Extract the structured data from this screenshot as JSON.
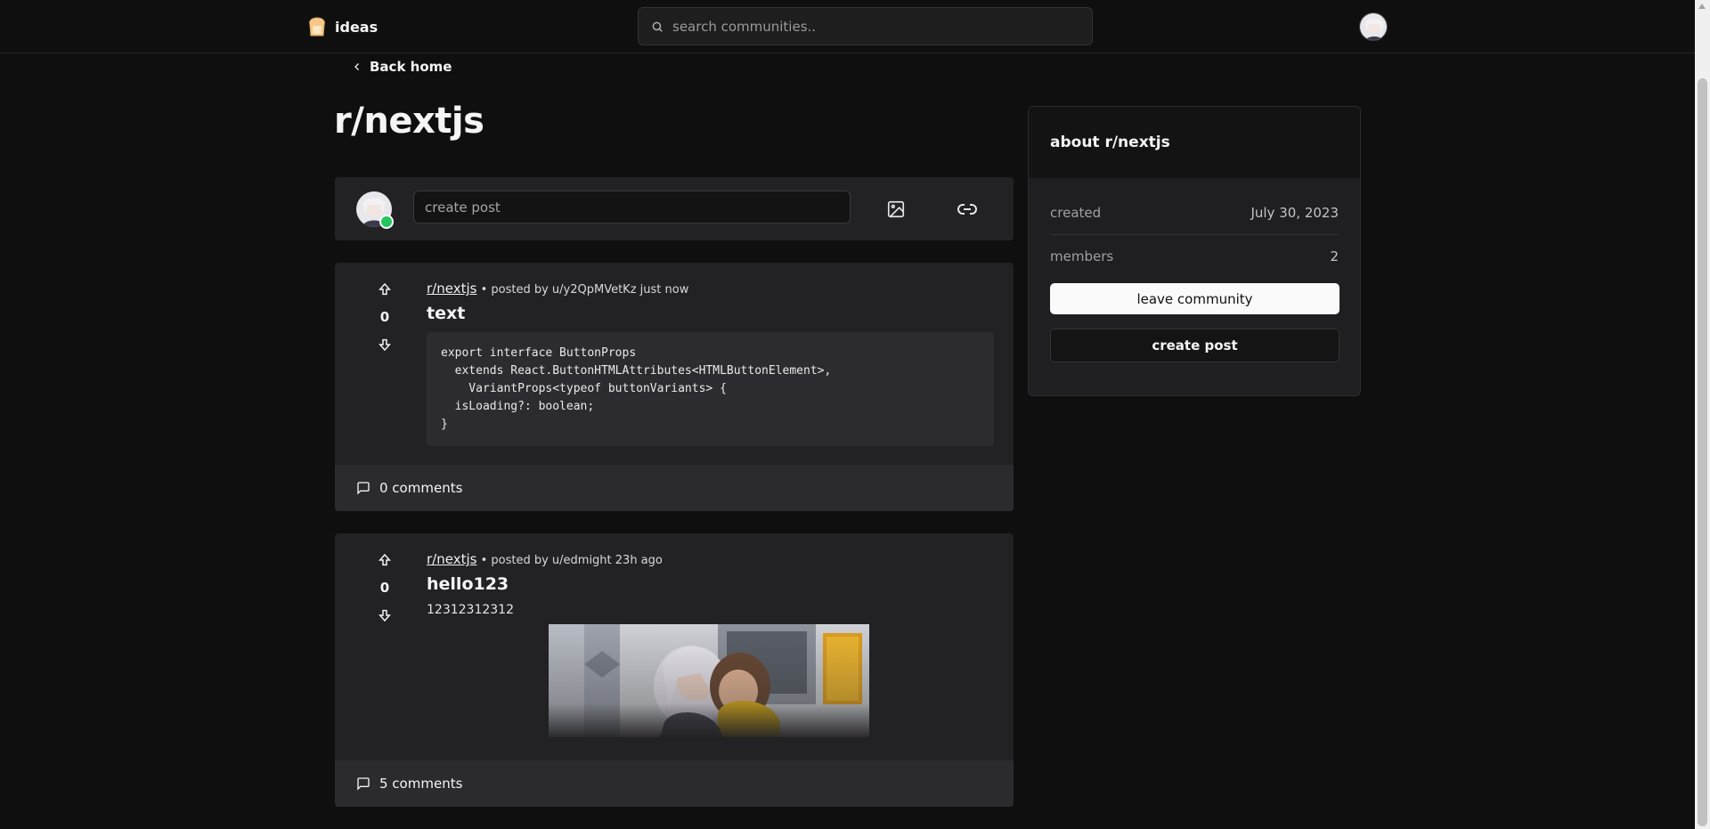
{
  "header": {
    "brand": "ideas",
    "search_placeholder": "search communities.."
  },
  "nav": {
    "back_label": "Back home"
  },
  "community": {
    "title": "r/nextjs"
  },
  "composer": {
    "placeholder": "create post"
  },
  "posts": [
    {
      "subreddit": "r/nextjs",
      "meta": " • posted by u/y2QpMVetKz just now",
      "title": "text",
      "votes": "0",
      "code": "export interface ButtonProps\n  extends React.ButtonHTMLAttributes<HTMLButtonElement>,\n    VariantProps<typeof buttonVariants> {\n  isLoading?: boolean;\n}",
      "comments": "0 comments"
    },
    {
      "subreddit": "r/nextjs",
      "meta": " • posted by u/edmight 23h ago",
      "title": "hello123",
      "votes": "0",
      "text": "12312312312",
      "comments": "5 comments"
    }
  ],
  "sidebar": {
    "heading": "about r/nextjs",
    "created_label": "created",
    "created_value": "July 30, 2023",
    "members_label": "members",
    "members_value": "2",
    "leave_label": "leave community",
    "create_label": "create post"
  },
  "colors": {
    "background": "#0f0f0f",
    "card": "#222224",
    "online": "#22c55e"
  }
}
